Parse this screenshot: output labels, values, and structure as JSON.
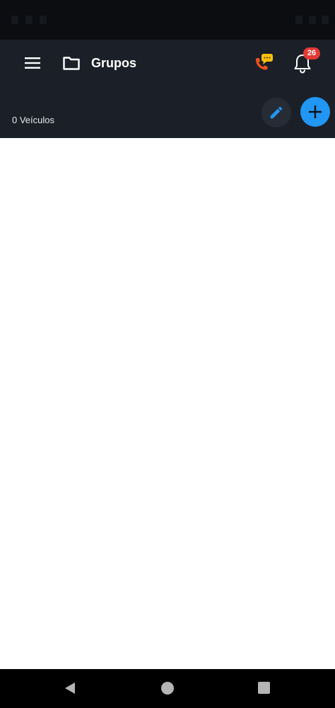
{
  "status_bar": {},
  "header": {
    "title": "Grupos",
    "notification_count": "26"
  },
  "summary": {
    "vehicle_count": "0 Veículos"
  },
  "icons": {
    "menu": "menu-icon",
    "folder": "folder-icon",
    "call_chat": "phone-chat-icon",
    "bell": "bell-icon",
    "edit": "pencil-icon",
    "add": "plus-icon"
  },
  "colors": {
    "app_bar": "#1b2028",
    "accent": "#2196f3",
    "badge": "#e53935",
    "call_icon": "#f4511e",
    "chat_bubble": "#ffc107"
  }
}
